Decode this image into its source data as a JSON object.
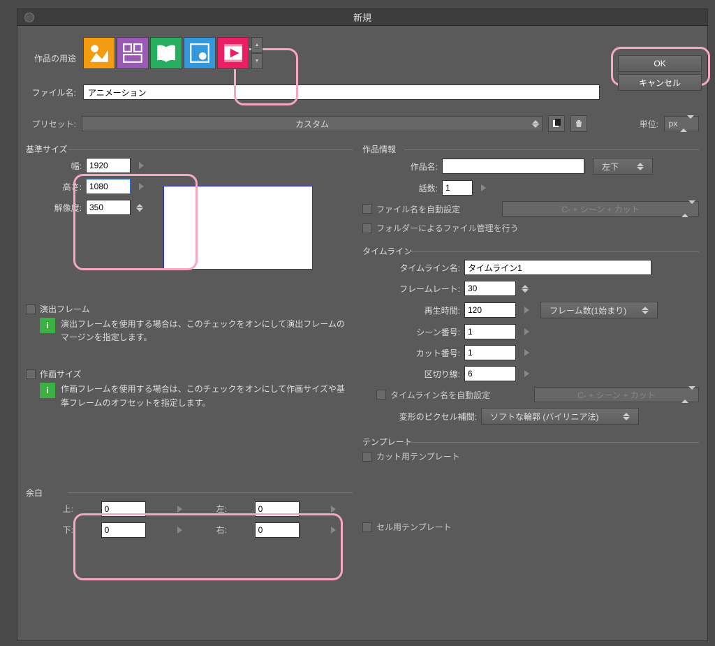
{
  "title": "新規",
  "purpose_label": "作品の用途",
  "buttons": {
    "ok": "OK",
    "cancel": "キャンセル"
  },
  "file": {
    "label": "ファイル名:",
    "value": "アニメーション"
  },
  "preset": {
    "label": "プリセット:",
    "value": "カスタム"
  },
  "unit": {
    "label": "単位:",
    "value": "px"
  },
  "base_size": {
    "title": "基準サイズ",
    "width_label": "幅:",
    "width": "1920",
    "height_label": "高さ:",
    "height": "1080",
    "res_label": "解像度:",
    "res": "350"
  },
  "direction_frame": {
    "title": "演出フレーム",
    "info": "演出フレームを使用する場合は、このチェックをオンにして演出フレームのマージンを指定します。"
  },
  "draw_size": {
    "title": "作画サイズ",
    "info": "作画フレームを使用する場合は、このチェックをオンにして作画サイズや基準フレームのオフセットを指定します。"
  },
  "margin": {
    "title": "余白",
    "top_label": "上:",
    "top": "0",
    "bottom_label": "下:",
    "bottom": "0",
    "left_label": "左:",
    "left": "0",
    "right_label": "右:",
    "right": "0"
  },
  "work_info": {
    "title": "作品情報",
    "name_label": "作品名:",
    "name": "",
    "pos_btn": "左下",
    "ep_label": "話数:",
    "ep": "1",
    "auto_filename": "ファイル名を自動設定",
    "folder_mgmt": "フォルダーによるファイル管理を行う",
    "disabled_field": "C- + シーン + カット"
  },
  "timeline": {
    "title": "タイムライン",
    "name_label": "タイムライン名:",
    "name": "タイムライン1",
    "fps_label": "フレームレート:",
    "fps": "30",
    "play_label": "再生時間:",
    "play": "120",
    "frame_btn": "フレーム数(1始まり)",
    "scene_label": "シーン番号:",
    "scene": "1",
    "cut_label": "カット番号:",
    "cut": "1",
    "sep_label": "区切り線:",
    "sep": "6",
    "auto_name": "タイムライン名を自動設定",
    "disabled_field": "C- + シーン + カット",
    "pixel_label": "変形のピクセル補間:",
    "pixel_method": "ソフトな輪郭 (バイリニア法)"
  },
  "template": {
    "title": "テンプレート",
    "cut": "カット用テンプレート",
    "cell": "セル用テンプレート"
  }
}
